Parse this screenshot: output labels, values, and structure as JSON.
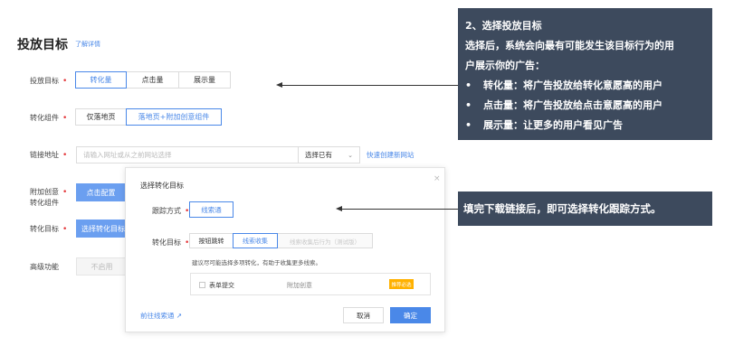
{
  "header": {
    "title": "投放目标",
    "learn_more": "了解详情"
  },
  "rows": {
    "target": {
      "label": "投放目标",
      "required": "•",
      "options": [
        "转化量",
        "点击量",
        "展示量"
      ],
      "selected": "转化量"
    },
    "component": {
      "label": "转化组件",
      "required": "•",
      "options": [
        "仅落地页",
        "落地页+附加创意组件"
      ],
      "selected": "落地页+附加创意组件"
    },
    "link": {
      "label": "链接地址",
      "required": "•",
      "placeholder": "请输入网址或从之前网站选择",
      "select_value": "选择已有",
      "create_link": "快速创建新网站"
    },
    "addon": {
      "label_line1": "附加创意",
      "label_line2": "转化组件",
      "required": "•",
      "button": "点击配置"
    },
    "conv_target": {
      "label": "转化目标",
      "required": "•",
      "button": "选择转化目标"
    },
    "advanced": {
      "label": "高级功能",
      "button": "不启用"
    }
  },
  "modal": {
    "title": "选择转化目标",
    "close": "×",
    "tracking_label": "跟踪方式",
    "required": "•",
    "tracking_option": "线索通",
    "target_label": "转化目标",
    "target_options": [
      "按钮跳转",
      "线索收集",
      "线索收集后行为（测试版）"
    ],
    "target_selected": "线索收集",
    "tip": "建议尽可能选择多项转化，有助于收集更多线索。",
    "list_item": {
      "name": "表单提交",
      "group": "附加创意",
      "badge": "推荐必选"
    },
    "goto_link": "前往线索通 ↗",
    "cancel": "取消",
    "ok": "确定"
  },
  "annotations": {
    "note1_title": "2、选择投放目标",
    "note1_desc_line1": "选择后，系统会向最有可能发生该目标行为的用",
    "note1_desc_line2": "户展示你的广告：",
    "bullets": [
      {
        "bullet": "•",
        "text": "转化量：将广告投放给转化意愿高的用户"
      },
      {
        "bullet": "•",
        "text": "点击量：将广告投放给点击意愿高的用户"
      },
      {
        "bullet": "•",
        "text": "展示量：让更多的用户看见广告"
      }
    ],
    "note2": "填完下载链接后，即可选择转化跟踪方式。"
  },
  "colors": {
    "accent": "#4a88e8",
    "note_bg": "#3d4a5d",
    "required": "#e4393c",
    "badge": "#ffb100"
  }
}
